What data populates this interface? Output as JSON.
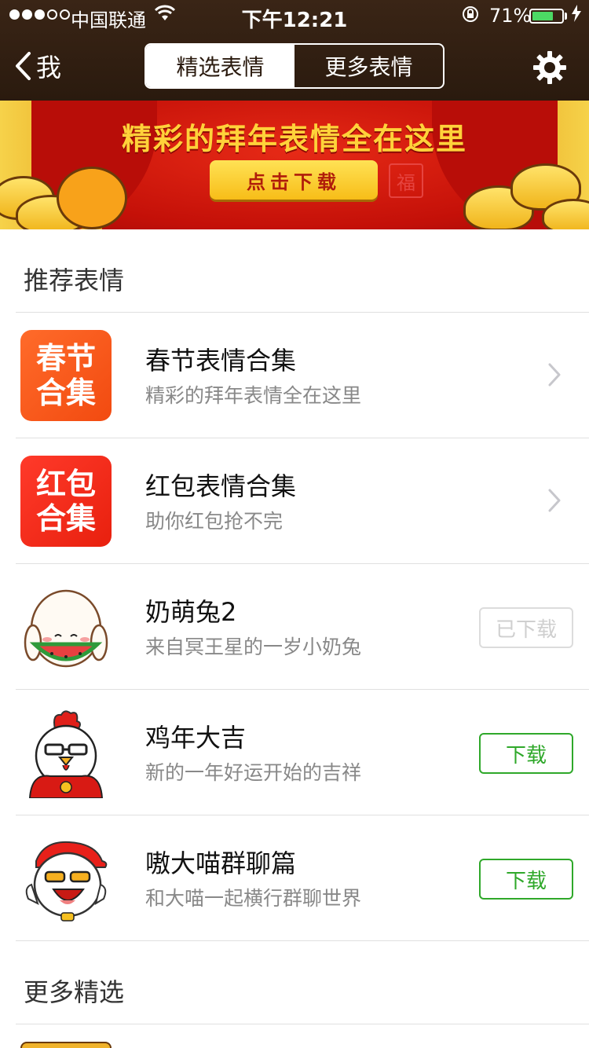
{
  "status_bar": {
    "carrier": "中国联通",
    "time": "下午12:21",
    "battery_percent": "71%",
    "battery_level": 0.71,
    "signal_bars_filled": 3,
    "signal_bars_total": 5
  },
  "nav": {
    "back_label": "我",
    "tabs": [
      {
        "label": "精选表情",
        "active": true
      },
      {
        "label": "更多表情",
        "active": false
      }
    ],
    "settings_icon": "gear-icon"
  },
  "banner": {
    "title": "精彩的拜年表情全在这里",
    "button": "点击下载",
    "stamp": "福"
  },
  "recommended": {
    "title": "推荐表情",
    "items": [
      {
        "title": "春节表情合集",
        "subtitle": "精彩的拜年表情全在这里",
        "icon_text": [
          "春节",
          "合集"
        ],
        "action": "chevron"
      },
      {
        "title": "红包表情合集",
        "subtitle": "助你红包抢不完",
        "icon_text": [
          "红包",
          "合集"
        ],
        "action": "chevron"
      },
      {
        "title": "奶萌兔2",
        "subtitle": "来自冥王星的一岁小奶兔",
        "icon": "rabbit-sticker-icon",
        "action": "已下载"
      },
      {
        "title": "鸡年大吉",
        "subtitle": "新的一年好运开始的吉祥",
        "icon": "rooster-sticker-icon",
        "action": "下载"
      },
      {
        "title": "嗷大喵群聊篇",
        "subtitle": "和大喵一起横行群聊世界",
        "icon": "cat-sticker-icon",
        "action": "下载"
      }
    ]
  },
  "more": {
    "title": "更多精选"
  },
  "colors": {
    "nav_bg": "#2a1a0e",
    "accent_green": "#2fa82a",
    "banner_red": "#c41008",
    "gold": "#ffd23a"
  }
}
